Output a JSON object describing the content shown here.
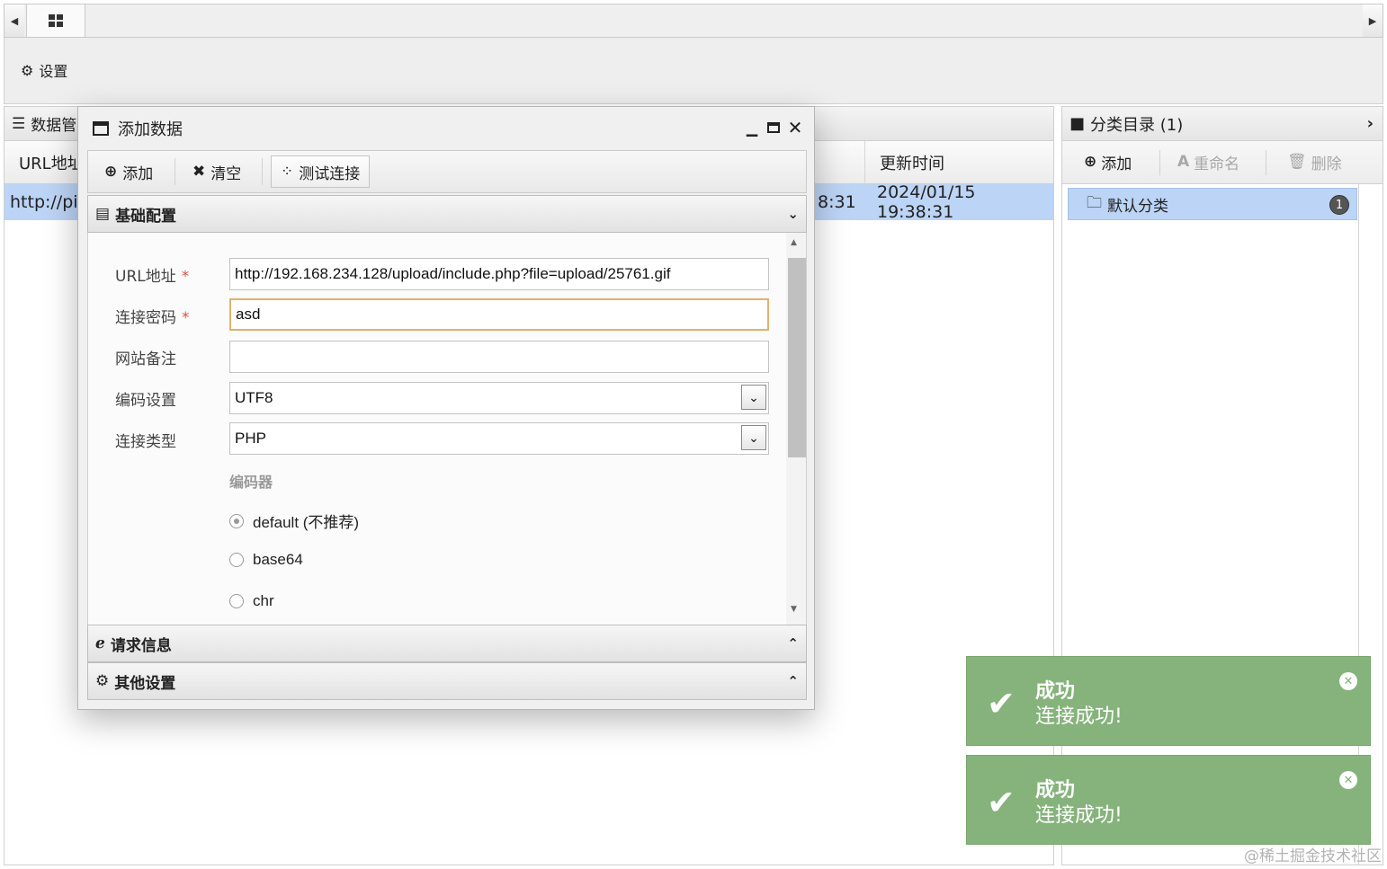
{
  "toolbar": {
    "settings_label": "设置"
  },
  "data_panel": {
    "title": "数据管",
    "columns": {
      "url": "URL地址",
      "update_time": "更新时间"
    },
    "row": {
      "url": "http://pi",
      "created_tail": "8:31",
      "updated": "2024/01/15 19:38:31"
    }
  },
  "category_panel": {
    "title": "分类目录 (1)",
    "buttons": {
      "add": "添加",
      "rename": "重命名",
      "delete": "删除"
    },
    "items": [
      {
        "label": "默认分类",
        "count": "1"
      }
    ]
  },
  "dialog": {
    "title": "添加数据",
    "toolbar": {
      "add": "添加",
      "clear": "清空",
      "test": "测试连接"
    },
    "sections": {
      "basic": "基础配置",
      "request": "请求信息",
      "other": "其他设置"
    },
    "form": {
      "url_label": "URL地址",
      "url_value": "http://192.168.234.128/upload/include.php?file=upload/25761.gif",
      "password_label": "连接密码",
      "password_value": "asd",
      "note_label": "网站备注",
      "note_value": "",
      "encoding_label": "编码设置",
      "encoding_value": "UTF8",
      "type_label": "连接类型",
      "type_value": "PHP",
      "required_mark": "*",
      "encoder_title": "编码器",
      "encoders": [
        {
          "label": "default (不推荐)",
          "selected": true
        },
        {
          "label": "base64",
          "selected": false
        },
        {
          "label": "chr",
          "selected": false
        }
      ]
    }
  },
  "toasts": [
    {
      "title": "成功",
      "message": "连接成功!"
    },
    {
      "title": "成功",
      "message": "连接成功!"
    }
  ],
  "watermark": "@稀土掘金技术社区",
  "colors": {
    "selection": "#bcd4f5",
    "toast_bg": "#86b37c",
    "focus_border": "#e0b26e",
    "required": "#d9534f"
  }
}
